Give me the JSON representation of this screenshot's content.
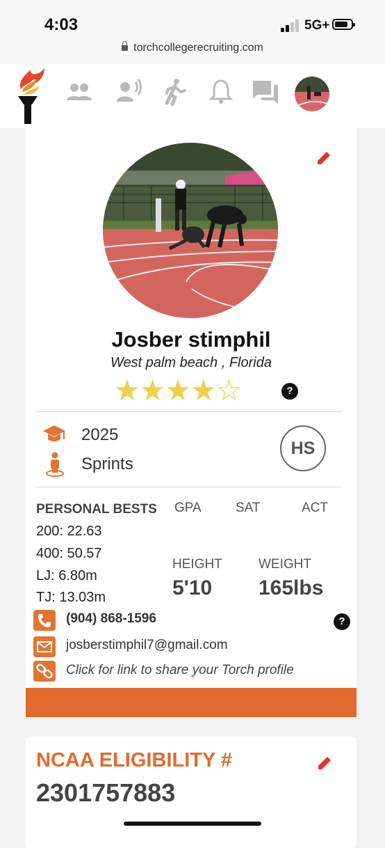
{
  "status_bar": {
    "time": "4:03",
    "network": "5G+"
  },
  "browser": {
    "url": "torchcollegerecruiting.com"
  },
  "nav": {
    "icons": [
      "torch-logo-icon",
      "people-icon",
      "recruiter-voice-icon",
      "running-icon",
      "bell-icon",
      "chat-icon",
      "profile-avatar"
    ],
    "icon_color": "#b9b9b9",
    "accent": "#e26a2c"
  },
  "profile": {
    "name": "Josber stimphil",
    "location": "West palm beach , Florida",
    "stars_filled": 4,
    "stars_total": 5,
    "stars_display": "★★★★☆",
    "help_mark": "?",
    "grad_year": "2025",
    "event": "Sprints",
    "level_badge": "HS"
  },
  "personal_bests": {
    "title": "PERSONAL BESTS",
    "items": [
      "200: 22.63",
      "400: 50.57",
      "LJ: 6.80m",
      "TJ: 13.03m"
    ]
  },
  "academics": {
    "gpa_label": "GPA",
    "sat_label": "SAT",
    "act_label": "ACT"
  },
  "physical": {
    "height_label": "HEIGHT",
    "height": "5'10",
    "weight_label": "WEIGHT",
    "weight": "165lbs"
  },
  "contact": {
    "phone": "(904) 868-1596",
    "email": "josberstimphil7@gmail.com",
    "share_link": "Click for link to share your Torch profile",
    "help_mark": "?"
  },
  "ncaa": {
    "title": "NCAA ELIGIBILITY #",
    "number": "2301757883"
  },
  "colors": {
    "orange": "#e26a2c",
    "star": "#f0d04a",
    "text": "#333333"
  }
}
